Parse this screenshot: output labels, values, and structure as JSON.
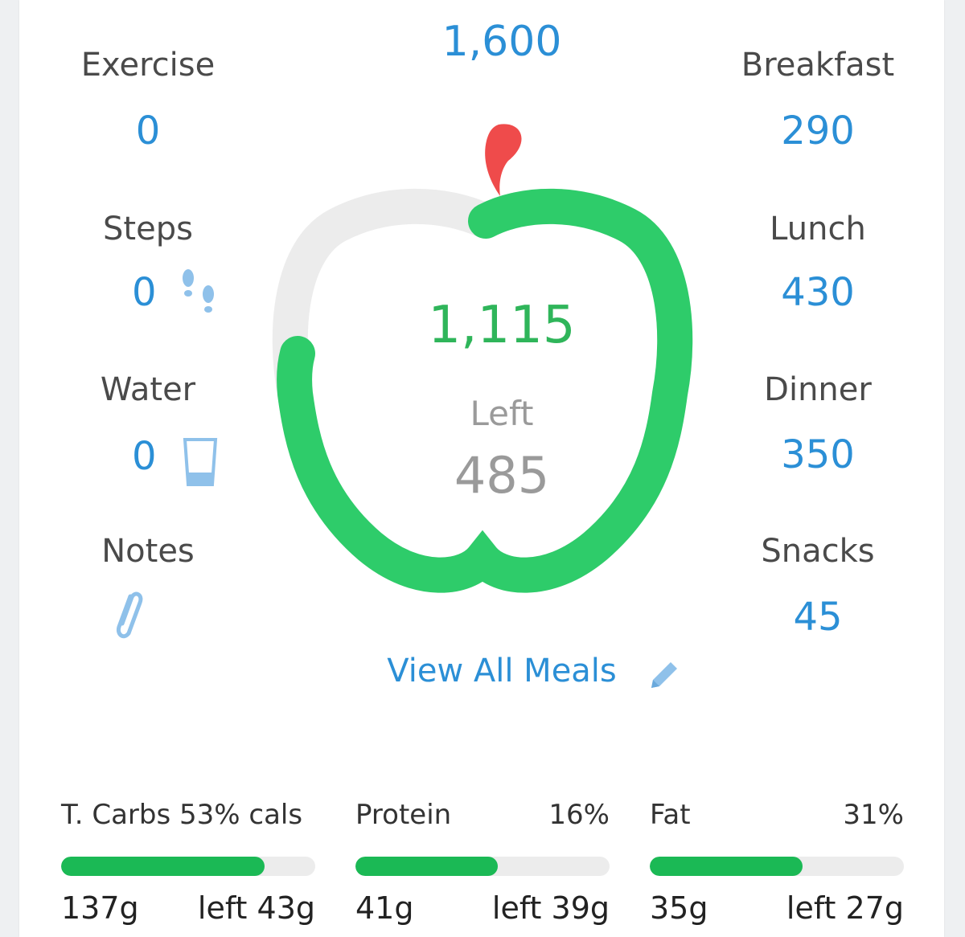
{
  "goal": "1,600",
  "left_column": {
    "exercise": {
      "label": "Exercise",
      "value": "0"
    },
    "steps": {
      "label": "Steps",
      "value": "0"
    },
    "water": {
      "label": "Water",
      "value": "0"
    },
    "notes": {
      "label": "Notes"
    }
  },
  "right_column": {
    "breakfast": {
      "label": "Breakfast",
      "value": "290"
    },
    "lunch": {
      "label": "Lunch",
      "value": "430"
    },
    "dinner": {
      "label": "Dinner",
      "value": "350"
    },
    "snacks": {
      "label": "Snacks",
      "value": "45"
    }
  },
  "apple": {
    "consumed": "1,115",
    "left_label": "Left",
    "left_value": "485",
    "progress_fraction": 0.697
  },
  "view_all_meals": "View All Meals",
  "macros": [
    {
      "label": "T. Carbs 53% cals",
      "pct": "",
      "fill": 0.8,
      "grams": "137g",
      "left": "left 43g"
    },
    {
      "label": "Protein",
      "pct": "16%",
      "fill": 0.56,
      "grams": "41g",
      "left": "left 39g"
    },
    {
      "label": "Fat",
      "pct": "31%",
      "fill": 0.6,
      "grams": "35g",
      "left": "left 27g"
    }
  ],
  "icons": {
    "steps": "footprints-icon",
    "water": "water-glass-icon",
    "notes": "paperclip-icon",
    "edit": "pencil-icon",
    "apple_leaf": "apple-leaf-icon"
  },
  "colors": {
    "accent_blue": "#2b8fd6",
    "ring_green": "#2ecc6a",
    "ring_track": "#ececec",
    "leaf_red": "#ef4b4b",
    "bar_green": "#1bb955"
  }
}
